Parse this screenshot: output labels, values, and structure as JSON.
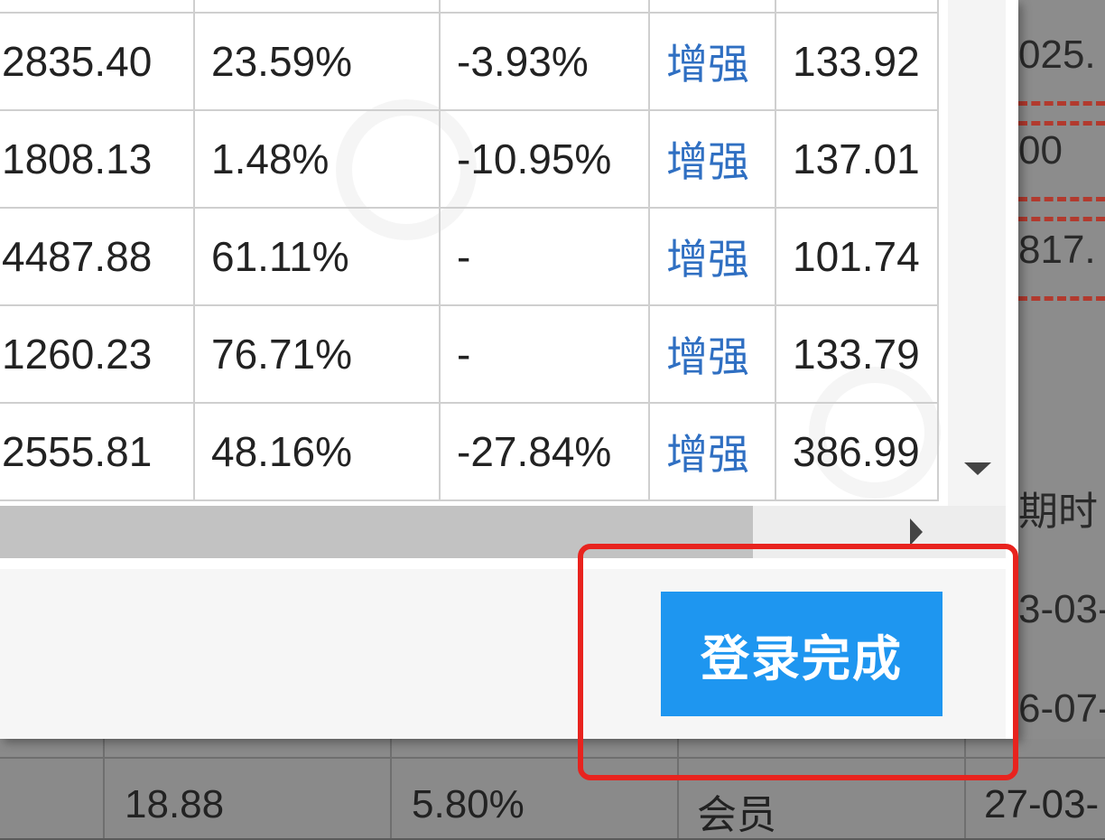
{
  "table": {
    "rows": [
      [
        "2835.40",
        "23.59%",
        "-3.93%",
        "增强",
        "133.92"
      ],
      [
        "1808.13",
        "1.48%",
        "-10.95%",
        "增强",
        "137.01"
      ],
      [
        "4487.88",
        "61.11%",
        "-",
        "增强",
        "101.74"
      ],
      [
        "1260.23",
        "76.71%",
        "-",
        "增强",
        "133.79"
      ],
      [
        "2555.81",
        "48.16%",
        "-27.84%",
        "增强",
        "386.99"
      ]
    ]
  },
  "background": {
    "right_column": [
      "025.",
      "00",
      "817.",
      "期时",
      "3-03-",
      "6-07-"
    ],
    "bottom_row": [
      "18.88",
      "5.80%",
      "会员",
      "27-03-"
    ]
  },
  "dialog": {
    "confirm_button_label": "登录完成"
  },
  "colors": {
    "button": "#1e96f0",
    "highlight": "#e8231e",
    "link": "#2f6fc2"
  },
  "icons": [
    "scroll-down-arrow-icon",
    "scroll-right-arrow-icon"
  ]
}
